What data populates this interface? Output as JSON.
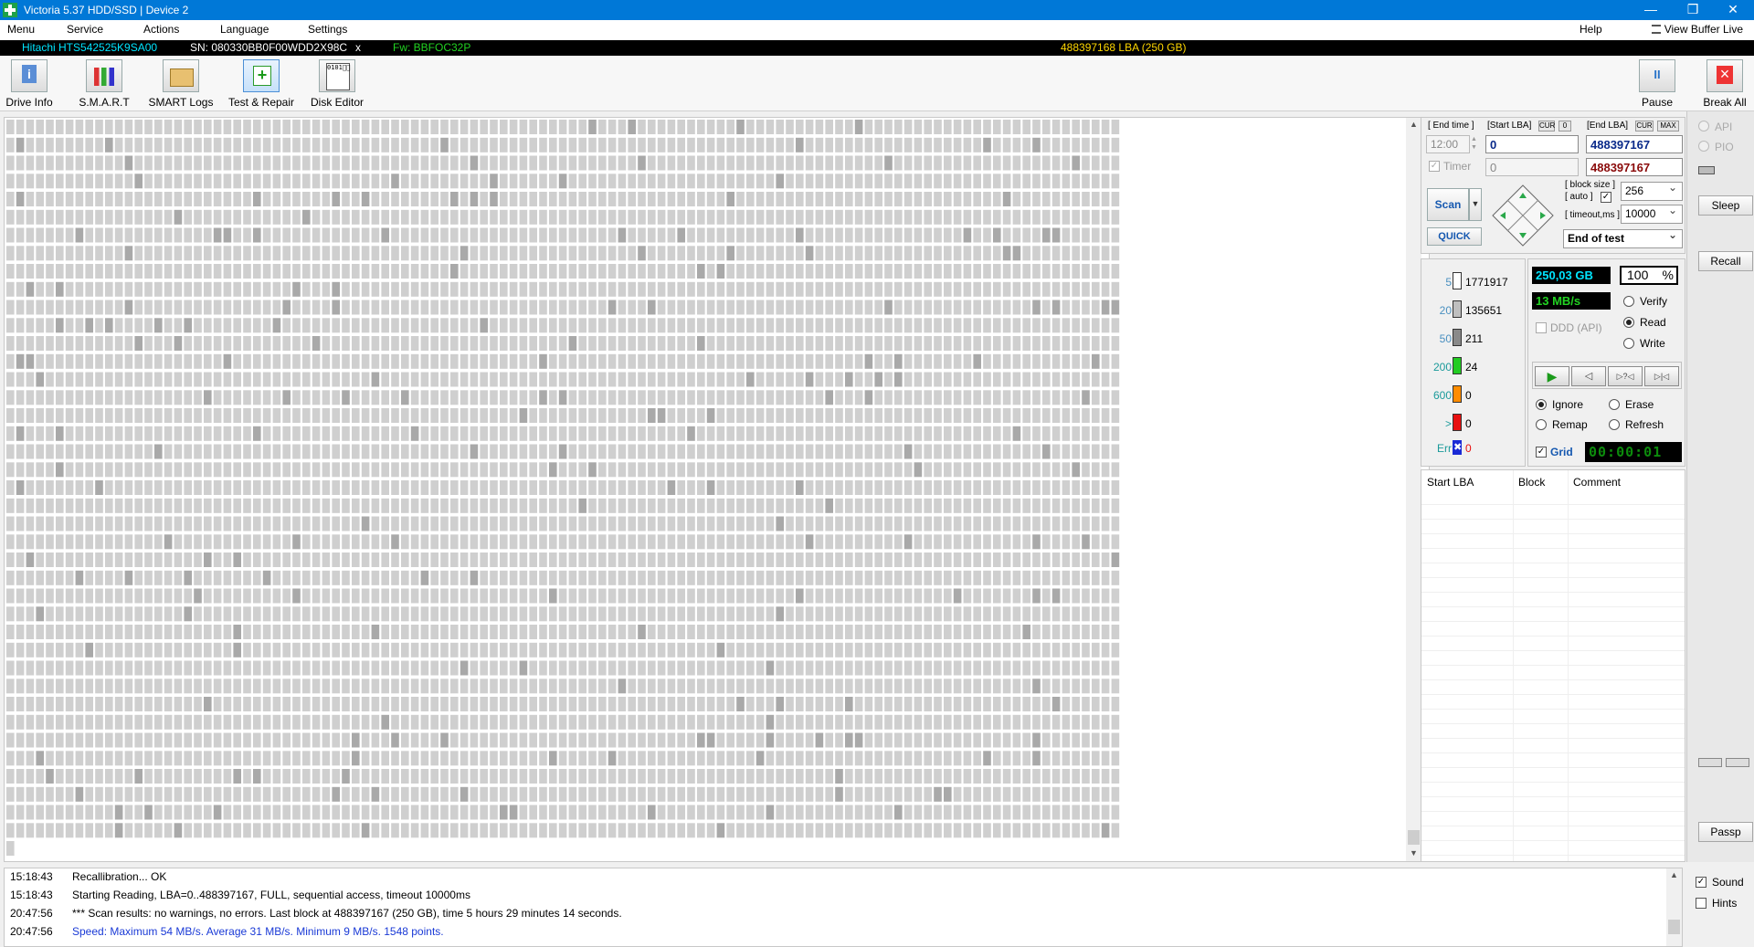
{
  "window": {
    "title": "Victoria 5.37 HDD/SSD | Device 2",
    "minimize": "—",
    "maximize": "❒",
    "close": "✕"
  },
  "menu": {
    "items": [
      "Menu",
      "Service",
      "Actions",
      "Language",
      "Settings"
    ],
    "help": "Help",
    "view_buffer_live": "View Buffer Live"
  },
  "info_strip": {
    "model": "Hitachi HTS542525K9SA00",
    "serial": "SN: 080330BB0F00WDD2X98C",
    "close_mark": "x",
    "firmware": "Fw: BBFOC32P",
    "capacity": "488397168 LBA (250 GB)",
    "colors": {
      "model": "#00e5ff",
      "serial": "#ffffff",
      "firmware": "#22d322",
      "capacity": "#ffd700"
    }
  },
  "toolbar": {
    "buttons": [
      {
        "label": "Drive Info",
        "icon": "info-icon"
      },
      {
        "label": "S.M.A.R.T",
        "icon": "smart-chart-icon"
      },
      {
        "label": "SMART Logs",
        "icon": "folder-icon"
      },
      {
        "label": "Test & Repair",
        "icon": "medkit-icon",
        "active": true
      },
      {
        "label": "Disk Editor",
        "icon": "binary-doc-icon"
      }
    ],
    "pause": "Pause",
    "break_all": "Break All"
  },
  "scan_map": {
    "block_color": "#cfcfcf",
    "slow_block_color": "#a9a9a9",
    "columns": 113,
    "rows": 41,
    "filled_cells": 4521
  },
  "test_panel": {
    "end_time_label": "[ End time ]",
    "end_time_value": "12:00",
    "start_lba_label": "[Start LBA]",
    "cur_label": "CUR",
    "zero_label": "0",
    "end_lba_label": "[End LBA]",
    "max_label": "MAX",
    "start_lba": "0",
    "end_lba": "488397167",
    "timer_label": "Timer",
    "timer_value": "0",
    "end_lba_2": "488397167",
    "scan_button": "Scan",
    "quick_button": "QUICK",
    "block_size_label": "[ block size ]",
    "auto_label": "[ auto ]",
    "block_size": "256",
    "timeout_label": "[ timeout,ms ]",
    "timeout": "10000",
    "end_action": "End of test",
    "colors": {
      "start_lba": "#0a2a8a",
      "end_lba": "#8a0a0a",
      "scan": "#1558b0"
    }
  },
  "stats": {
    "rows": [
      {
        "label": "5",
        "count": "1771917",
        "color": "#ffffff",
        "label_color": "#4a90c0"
      },
      {
        "label": "20",
        "count": "135651",
        "color": "#bfbfbf",
        "label_color": "#4a90c0"
      },
      {
        "label": "50",
        "count": "211",
        "color": "#8a8a8a",
        "label_color": "#4a90c0"
      },
      {
        "label": "200",
        "count": "24",
        "color": "#22cc22",
        "label_color": "#1a9a9a"
      },
      {
        "label": "600",
        "count": "0",
        "color": "#ff8c00",
        "label_color": "#1a9a9a"
      },
      {
        "label": ">",
        "count": "0",
        "color": "#e81010",
        "label_color": "#1a9a9a"
      }
    ],
    "err_label": "Err",
    "err_count": "0",
    "err_color": "#e81010"
  },
  "progress": {
    "size": "250,03 GB",
    "percent": "100",
    "percent_sign": "%",
    "speed": "13 MB/s",
    "ddd_label": "DDD (API)",
    "timer_display": "00:00:01",
    "colors": {
      "size": "#00e5ff",
      "speed": "#22d322",
      "percent": "#000000",
      "lcd": "#0c8c0c"
    }
  },
  "modes": {
    "verify": "Verify",
    "read": "Read",
    "write": "Write",
    "selected": "Read"
  },
  "actions": {
    "ignore": "Ignore",
    "erase": "Erase",
    "remap": "Remap",
    "refresh": "Refresh",
    "selected": "Ignore",
    "grid_label": "Grid"
  },
  "playback": [
    "▶",
    "◁",
    "▷?◁",
    "▷|◁"
  ],
  "defects_table": {
    "columns": [
      "Start LBA",
      "Block",
      "Comment"
    ]
  },
  "side": {
    "api": "API",
    "pio": "PIO",
    "sleep": "Sleep",
    "recall": "Recall",
    "passp": "Passp",
    "sound": "Sound",
    "hints": "Hints"
  },
  "log": [
    {
      "time": "15:18:43",
      "text": "Recallibration... OK",
      "color": "#000000"
    },
    {
      "time": "15:18:43",
      "text": "Starting Reading, LBA=0..488397167, FULL, sequential access, timeout 10000ms",
      "color": "#000000"
    },
    {
      "time": "20:47:56",
      "text": "*** Scan results: no warnings, no errors. Last block at 488397167 (250 GB), time 5 hours 29 minutes 14 seconds.",
      "color": "#000000"
    },
    {
      "time": "20:47:56",
      "text": "Speed: Maximum 54 MB/s. Average 31 MB/s. Minimum 9 MB/s. 1548 points.",
      "color": "#1a3ad6"
    }
  ]
}
